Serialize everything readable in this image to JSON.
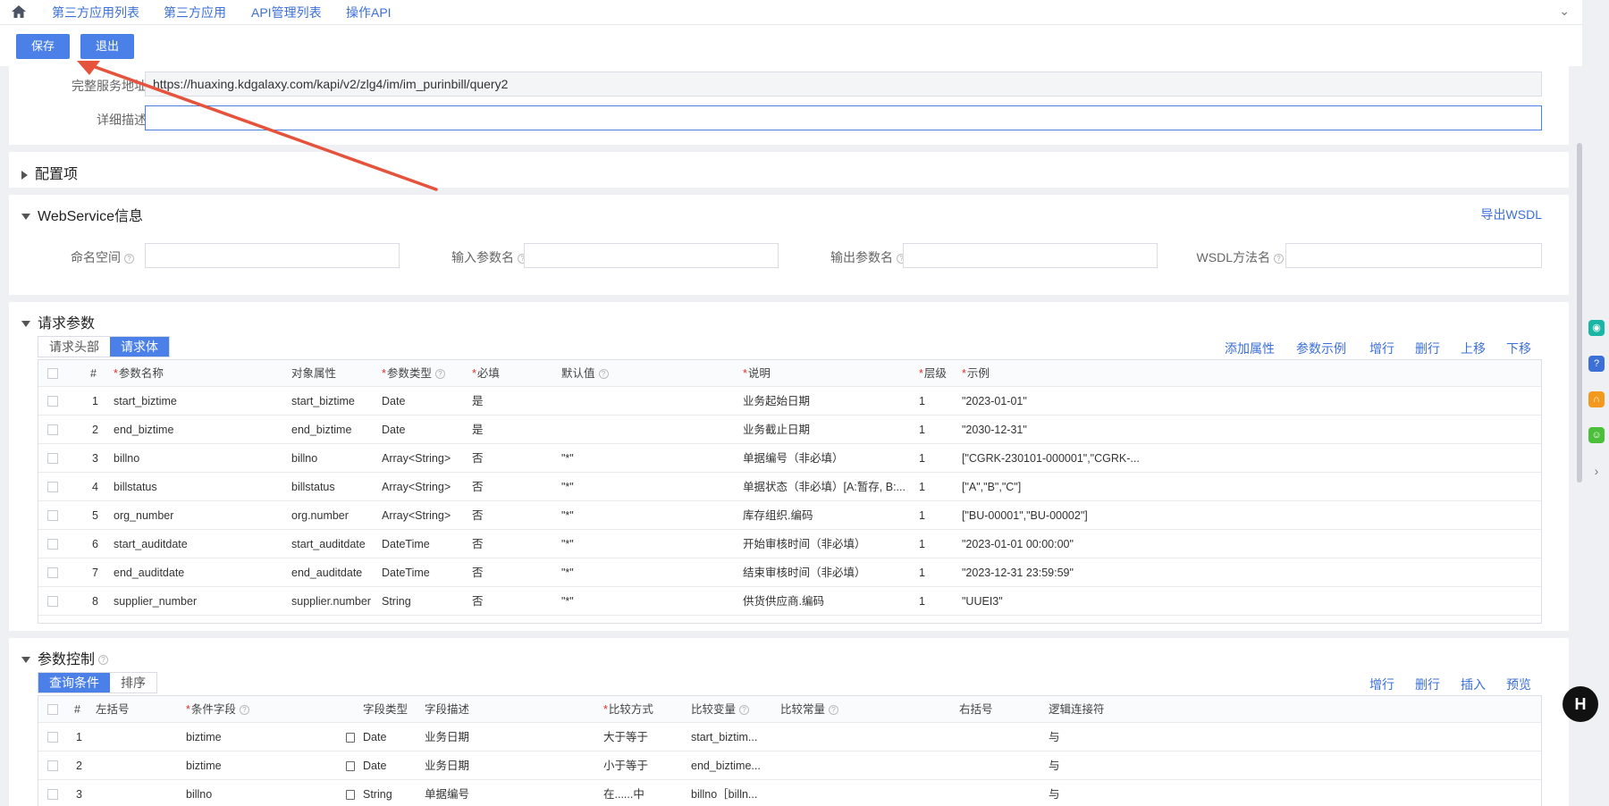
{
  "tabs": [
    "第三方应用列表",
    "第三方应用",
    "API管理列表",
    "操作API"
  ],
  "toolbar": {
    "save": "保存",
    "exit": "退出"
  },
  "basic": {
    "url_label": "完整服务地址",
    "url_value": "https://huaxing.kdgalaxy.com/kapi/v2/zlg4/im/im_purinbill/query2",
    "desc_label": "详细描述",
    "desc_value": ""
  },
  "config": {
    "title": "配置项"
  },
  "webservice": {
    "title": "WebService信息",
    "export": "导出WSDL",
    "fields": [
      "命名空间",
      "输入参数名",
      "输出参数名",
      "WSDL方法名"
    ]
  },
  "request": {
    "title": "请求参数",
    "subtabs": [
      "请求头部",
      "请求体"
    ],
    "actions": [
      "添加属性",
      "参数示例",
      "增行",
      "删行",
      "上移",
      "下移"
    ],
    "columns": [
      "#",
      "参数名称",
      "对象属性",
      "参数类型",
      "必填",
      "默认值",
      "说明",
      "层级",
      "示例"
    ],
    "rows": [
      [
        "1",
        "start_biztime",
        "start_biztime",
        "Date",
        "是",
        "",
        "业务起始日期",
        "1",
        "\"2023-01-01\""
      ],
      [
        "2",
        "end_biztime",
        "end_biztime",
        "Date",
        "是",
        "",
        "业务截止日期",
        "1",
        "\"2030-12-31\""
      ],
      [
        "3",
        "billno",
        "billno",
        "Array<String>",
        "否",
        "\"*\"",
        "单据编号（非必填）",
        "1",
        "[\"CGRK-230101-000001\",\"CGRK-..."
      ],
      [
        "4",
        "billstatus",
        "billstatus",
        "Array<String>",
        "否",
        "\"*\"",
        "单据状态（非必填）[A:暂存, B:...",
        "1",
        "[\"A\",\"B\",\"C\"]"
      ],
      [
        "5",
        "org_number",
        "org.number",
        "Array<String>",
        "否",
        "\"*\"",
        "库存组织.编码",
        "1",
        "[\"BU-00001\",\"BU-00002\"]"
      ],
      [
        "6",
        "start_auditdate",
        "start_auditdate",
        "DateTime",
        "否",
        "\"*\"",
        "开始审核时间（非必填）",
        "1",
        "\"2023-01-01 00:00:00\""
      ],
      [
        "7",
        "end_auditdate",
        "end_auditdate",
        "DateTime",
        "否",
        "\"*\"",
        "结束审核时间（非必填）",
        "1",
        "\"2023-12-31 23:59:59\""
      ],
      [
        "8",
        "supplier_number",
        "supplier.number",
        "String",
        "否",
        "\"*\"",
        "供货供应商.编码",
        "1",
        "\"UUEI3\""
      ]
    ]
  },
  "paramctrl": {
    "title": "参数控制",
    "subtabs": [
      "查询条件",
      "排序"
    ],
    "actions": [
      "增行",
      "删行",
      "插入",
      "预览"
    ],
    "columns": [
      "#",
      "左括号",
      "条件字段",
      "字段类型",
      "字段描述",
      "比较方式",
      "比较变量",
      "比较常量",
      "右括号",
      "逻辑连接符"
    ],
    "rows": [
      [
        "1",
        "",
        "biztime",
        "Date",
        "业务日期",
        "大于等于",
        "start_biztim...",
        "",
        "",
        "与"
      ],
      [
        "2",
        "",
        "biztime",
        "Date",
        "业务日期",
        "小于等于",
        "end_biztime...",
        "",
        "",
        "与"
      ],
      [
        "3",
        "",
        "billno",
        "String",
        "单据编号",
        "在......中",
        "billno［billn...",
        "",
        "",
        "与"
      ]
    ]
  },
  "colors": {
    "accent": "#4a80e8",
    "link": "#3c6fd8",
    "arrow": "#e5533d"
  },
  "side_icons": [
    "chat-icon",
    "help-icon",
    "headset-icon",
    "smile-icon",
    "expand-icon"
  ]
}
